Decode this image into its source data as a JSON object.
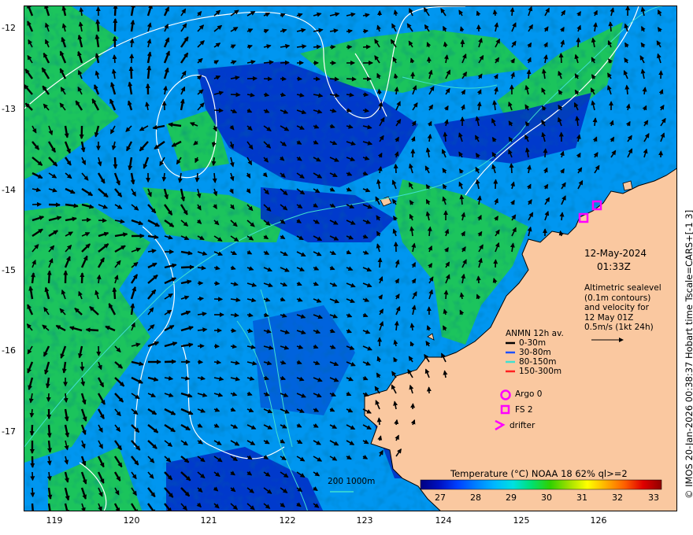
{
  "axes": {
    "lat_ticks": [
      "-12",
      "-13",
      "-14",
      "-15",
      "-16",
      "-17"
    ],
    "lon_ticks": [
      "119",
      "120",
      "121",
      "122",
      "123",
      "124",
      "125",
      "126"
    ]
  },
  "annotation": {
    "date": "12-May-2024",
    "time": "01:33Z",
    "altimetry_lines": [
      "Altimetric sealevel",
      "(0.1m contours)",
      "and velocity for",
      "12 May 01Z",
      "0.5m/s (1kt 24h)"
    ]
  },
  "legend": {
    "title": "ANMN 12h av.",
    "items": [
      {
        "label": "0-30m",
        "color": "#000000"
      },
      {
        "label": "30-80m",
        "color": "#1e50ff"
      },
      {
        "label": "80-150m",
        "color": "#40e0d0"
      },
      {
        "label": "150-300m",
        "color": "#ff2020"
      }
    ],
    "markers": [
      {
        "label": "Argo 0",
        "icon": "circle-icon",
        "color": "#ff00ff"
      },
      {
        "label": "FS 2",
        "icon": "square-icon",
        "color": "#ff00ff"
      },
      {
        "label": "drifter",
        "icon": "chevron-right-icon",
        "color": "#ff00ff"
      }
    ]
  },
  "depth_legend": {
    "label": "200  1000m"
  },
  "colorbar": {
    "title": "Temperature (°C) NOAA 18 62% ql>=2",
    "ticks": [
      "27",
      "28",
      "29",
      "30",
      "31",
      "32",
      "33"
    ],
    "colors": [
      "#000080",
      "#0010c0",
      "#0040ff",
      "#0080ff",
      "#00b8ff",
      "#00e0e0",
      "#00e070",
      "#30d000",
      "#a0e000",
      "#ffff00",
      "#ffb000",
      "#ff6000",
      "#e00000",
      "#900000"
    ]
  },
  "credit": "© IMOS 20-Jan-2026 00:38:37 Hobart time Tscale=CARS+[-1 3]",
  "colors": {
    "land": "#fac8a0",
    "water_cold": "#0030c8",
    "water_mid": "#0096f0",
    "water_warm": "#1ec850",
    "contour": "#ffffff",
    "isobath": "#40e0d0",
    "marker": "#ff00ff"
  }
}
